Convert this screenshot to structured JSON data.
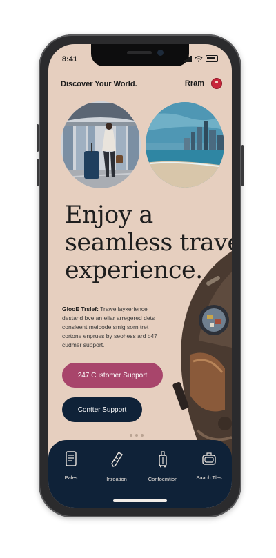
{
  "status_bar": {
    "time": "8:41"
  },
  "header": {
    "brand": "Discover Your World.",
    "user_name": "Rram"
  },
  "hero": {
    "headline_lines": [
      "Enjoy a",
      "seamless travel",
      "experience."
    ]
  },
  "description": {
    "lead": "GlooE Trslef:",
    "lines": [
      "Trawe layxerience",
      "destand bve an eiiar arregered dets",
      "consleent meibode smig sorn tret",
      "cortone enprues by seohess ard b47",
      "cudmer support."
    ]
  },
  "buttons": {
    "support_label": "247 Customer Support",
    "contact_label": "Contter Support"
  },
  "tabs": [
    {
      "label": "Pales",
      "icon": "card-icon"
    },
    {
      "label": "Irtreation",
      "icon": "ticket-icon"
    },
    {
      "label": "Confoemtion",
      "icon": "luggage-icon"
    },
    {
      "label": "Saach Tles",
      "icon": "suitcase-icon"
    }
  ],
  "colors": {
    "background": "#e6cfbf",
    "accent_rose": "#a8456b",
    "navy": "#0f2238",
    "avatar_red": "#c8263a"
  }
}
